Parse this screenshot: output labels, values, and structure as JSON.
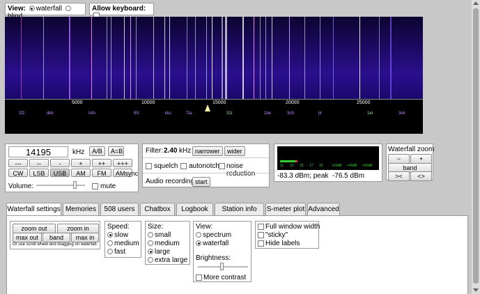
{
  "top": {
    "view_label": "View:",
    "view_waterfall": "waterfall",
    "view_blind": "blind",
    "keyboard_label": "Allow keyboard:"
  },
  "scale": {
    "ticks": [
      "5000",
      "10000",
      "15000",
      "20000",
      "25000"
    ],
    "stations": [
      "2f2",
      "dkb",
      "Info",
      "BS",
      "kkc",
      "7ta",
      "31t",
      "1be",
      "3c9",
      "jtr",
      "1el",
      "3ek"
    ]
  },
  "freq": {
    "value": "14195",
    "unit": "kHz",
    "ab": "A/B",
    "a_eq_b": "A=B",
    "steps": [
      "---",
      "--",
      "-",
      "+",
      "++",
      "+++"
    ],
    "modes": [
      "CW",
      "LSB",
      "USB",
      "AM",
      "FM",
      "AMsync"
    ],
    "volume_label": "Volume:",
    "mute_label": "mute"
  },
  "filter": {
    "label": "Filter:",
    "value": "2.40",
    "unit": "kHz",
    "narrower": "narrower",
    "wider": "wider",
    "squelch": "squelch",
    "autonotch": "autonotch",
    "noise_reduction": "noise reduction",
    "audio_recording": "Audio recording",
    "start": "start"
  },
  "smeter": {
    "scale_labels": [
      "11",
      "13",
      "15",
      "17",
      "19",
      "+20dB",
      "+40dB",
      "+60dB"
    ],
    "readout": "-83.3 dBm; peak  -76.5 dBm",
    "level_fraction": 0.16
  },
  "wfzoom": {
    "title": "Waterfall zoom",
    "minus": "−",
    "plus": "+",
    "band": "band",
    "left": "><",
    "right": "<>"
  },
  "tabs": [
    "Waterfall settings",
    "Memories",
    "508 users",
    "Chatbox",
    "Logbook",
    "Station info",
    "S-meter plot",
    "Advanced"
  ],
  "settings": {
    "zoom_out": "zoom out",
    "zoom_in": "zoom in",
    "max_out": "max out",
    "band": "band",
    "max_in": "max in",
    "hint": "Or use scroll wheel and dragging on waterfall.",
    "speed_label": "Speed:",
    "speed_opts": [
      "slow",
      "medium",
      "fast"
    ],
    "size_label": "Size:",
    "size_opts": [
      "small",
      "medium",
      "large",
      "extra large"
    ],
    "view_label": "View:",
    "view_opts": [
      "spectrum",
      "waterfall"
    ],
    "brightness_label": "Brightness:",
    "more_contrast": "More contrast",
    "full_window": "Full window width",
    "sticky": "\"sticky\"",
    "hide_labels": "Hide labels"
  },
  "colors": {
    "waterfall_bg": "#1d0a66",
    "meter_green": "#3c3",
    "meter_red": "#d33"
  }
}
